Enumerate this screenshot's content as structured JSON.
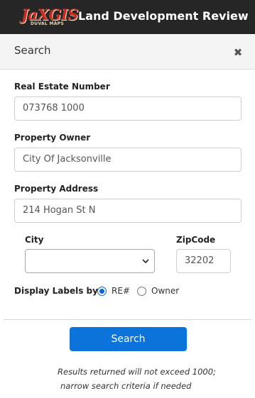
{
  "header": {
    "logo_text": "JaXGIS",
    "logo_subtext": "DUVAL MAPS",
    "title": "Land Development Review"
  },
  "panel": {
    "title": "Search",
    "close_label": "✖"
  },
  "form": {
    "re_label": "Real Estate Number",
    "re_value": "073768 1000",
    "owner_label": "Property Owner",
    "owner_value": "City Of Jacksonville",
    "address_label": "Property Address",
    "address_value": "214 Hogan St N",
    "city_label": "City",
    "city_value": "",
    "zip_label": "ZipCode",
    "zip_value": "32202",
    "display_labels_label": "Display Labels by:",
    "radio_options": [
      {
        "label": "RE#",
        "checked": true
      },
      {
        "label": "Owner",
        "checked": false
      }
    ],
    "search_button": "Search",
    "note_line1": "Results returned will not exceed 1000;",
    "note_line2": "narrow search criteria if needed"
  },
  "colors": {
    "header_bg": "#262626",
    "accent": "#0b73d9",
    "logo_red": "#cc2a1e"
  },
  "icons": {
    "close": "close-icon",
    "dropdown": "chevron-down-icon"
  }
}
